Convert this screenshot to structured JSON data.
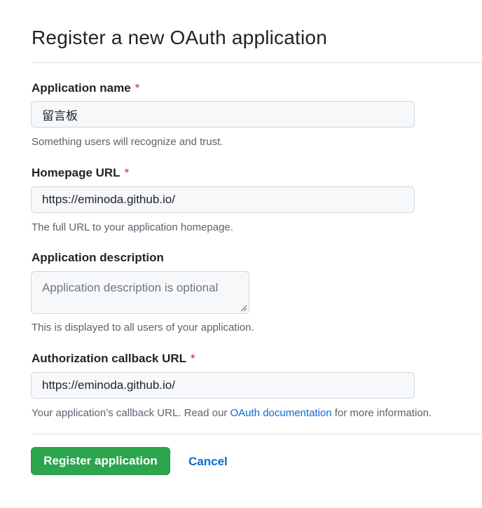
{
  "page": {
    "title": "Register a new OAuth application"
  },
  "form": {
    "app_name": {
      "label": "Application name",
      "required_mark": "*",
      "value": "留言板",
      "hint": "Something users will recognize and trust."
    },
    "homepage_url": {
      "label": "Homepage URL",
      "required_mark": "*",
      "value": "https://eminoda.github.io/",
      "hint": "The full URL to your application homepage."
    },
    "description": {
      "label": "Application description",
      "placeholder": "Application description is optional",
      "value": "",
      "hint": "This is displayed to all users of your application."
    },
    "callback_url": {
      "label": "Authorization callback URL",
      "required_mark": "*",
      "value": "https://eminoda.github.io/",
      "hint_before": "Your application’s callback URL. Read our ",
      "hint_link": "OAuth documentation",
      "hint_after": " for more information."
    }
  },
  "actions": {
    "register_label": "Register application",
    "cancel_label": "Cancel"
  },
  "colors": {
    "primary_button": "#2da44e",
    "link": "#0969da",
    "required": "#d1242f"
  }
}
